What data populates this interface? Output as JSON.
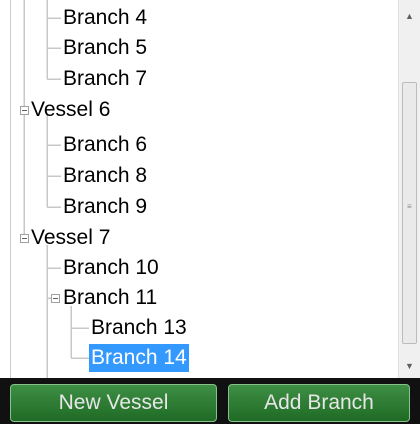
{
  "tree": {
    "vessel6_label": "Vessel 6",
    "vessel7_label": "Vessel 7",
    "items": [
      {
        "label": "Branch 4"
      },
      {
        "label": "Branch 5"
      },
      {
        "label": "Branch 7"
      },
      {
        "label": "Vessel 6"
      },
      {
        "label": "Branch 6"
      },
      {
        "label": "Branch 8"
      },
      {
        "label": "Branch 9"
      },
      {
        "label": "Vessel 7"
      },
      {
        "label": "Branch 10"
      },
      {
        "label": "Branch 11"
      },
      {
        "label": "Branch 13"
      },
      {
        "label": "Branch 14"
      }
    ],
    "selected_label": "Branch 14",
    "line_color": "#c8c8c8",
    "selection_color": "#3399ff"
  },
  "toolbar": {
    "new_vessel_label": "New Vessel",
    "add_branch_label": "Add Branch",
    "button_color": "#2e7d32",
    "bar_color": "#111111"
  },
  "scrollbar": {
    "up_icon": "arrow-up-icon",
    "down_icon": "arrow-down-icon"
  }
}
